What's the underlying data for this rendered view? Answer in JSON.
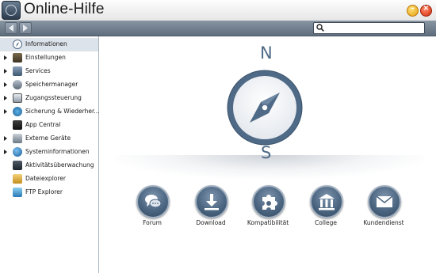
{
  "window": {
    "title": "Online-Hilfe",
    "minimize_symbol": "–",
    "close_symbol": "×"
  },
  "toolbar": {
    "back_icon": "arrow-left-icon",
    "forward_icon": "arrow-right-icon",
    "search_icon": "magnifier-icon",
    "search_placeholder": ""
  },
  "sidebar": {
    "items": [
      {
        "label": "Informationen",
        "icon": "compass-icon",
        "expandable": false,
        "selected": true
      },
      {
        "label": "Einstellungen",
        "icon": "settings-icon",
        "expandable": true,
        "selected": false
      },
      {
        "label": "Services",
        "icon": "services-icon",
        "expandable": true,
        "selected": false
      },
      {
        "label": "Speichermanager",
        "icon": "storage-icon",
        "expandable": true,
        "selected": false
      },
      {
        "label": "Zugangssteuerung",
        "icon": "access-control-icon",
        "expandable": true,
        "selected": false
      },
      {
        "label": "Sicherung & Wiederher...",
        "icon": "backup-icon",
        "expandable": true,
        "selected": false
      },
      {
        "label": "App Central",
        "icon": "app-central-icon",
        "expandable": false,
        "selected": false
      },
      {
        "label": "Externe Geräte",
        "icon": "external-devices-icon",
        "expandable": true,
        "selected": false
      },
      {
        "label": "Systeminformationen",
        "icon": "system-info-icon",
        "expandable": true,
        "selected": false
      },
      {
        "label": "Aktivitätsüberwachung",
        "icon": "activity-monitor-icon",
        "expandable": false,
        "selected": false
      },
      {
        "label": "Dateiexplorer",
        "icon": "file-explorer-icon",
        "expandable": false,
        "selected": false
      },
      {
        "label": "FTP Explorer",
        "icon": "ftp-explorer-icon",
        "expandable": false,
        "selected": false
      }
    ]
  },
  "main": {
    "compass": {
      "north": "N",
      "south": "S"
    },
    "links": [
      {
        "label": "Forum",
        "icon": "chat-bubbles-icon"
      },
      {
        "label": "Download",
        "icon": "download-icon"
      },
      {
        "label": "Kompatibilität",
        "icon": "puzzle-icon"
      },
      {
        "label": "College",
        "icon": "building-columns-icon"
      },
      {
        "label": "Kundendienst",
        "icon": "envelope-icon"
      }
    ]
  },
  "colors": {
    "toolbar": "#6f7d8c",
    "accent": "#4c6682",
    "selection": "#dde3ea"
  }
}
